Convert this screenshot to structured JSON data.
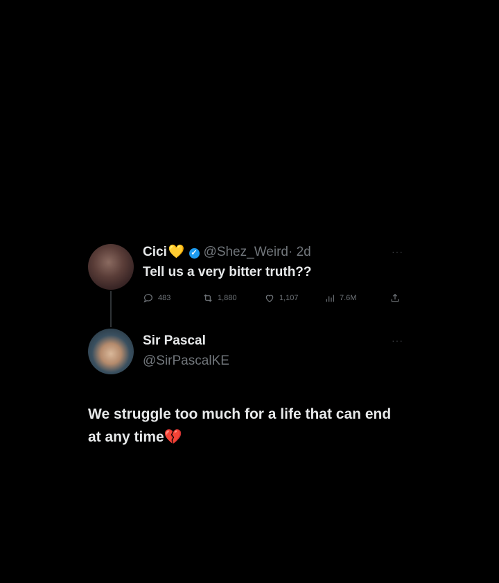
{
  "original_tweet": {
    "author_name": "Cici",
    "name_emoji": "💛",
    "handle": "@Shez_Weird",
    "time": "· 2d",
    "text": "Tell us a very bitter truth??",
    "stats": {
      "replies": "483",
      "retweets": "1,880",
      "likes": "1,107",
      "views": "7.6M"
    },
    "more_label": "···"
  },
  "reply": {
    "author_name": "Sir Pascal",
    "handle": "@SirPascalKE",
    "text": "We struggle too much for a life that can end at any time",
    "text_emoji": "💔",
    "more_label": "···"
  },
  "icons": [
    "reply-icon",
    "retweet-icon",
    "like-icon",
    "views-icon",
    "share-icon",
    "verified-icon"
  ],
  "colors": {
    "background": "#000000",
    "text": "#e7e9ea",
    "muted": "#71767b",
    "verified": "#1d9bf0"
  }
}
